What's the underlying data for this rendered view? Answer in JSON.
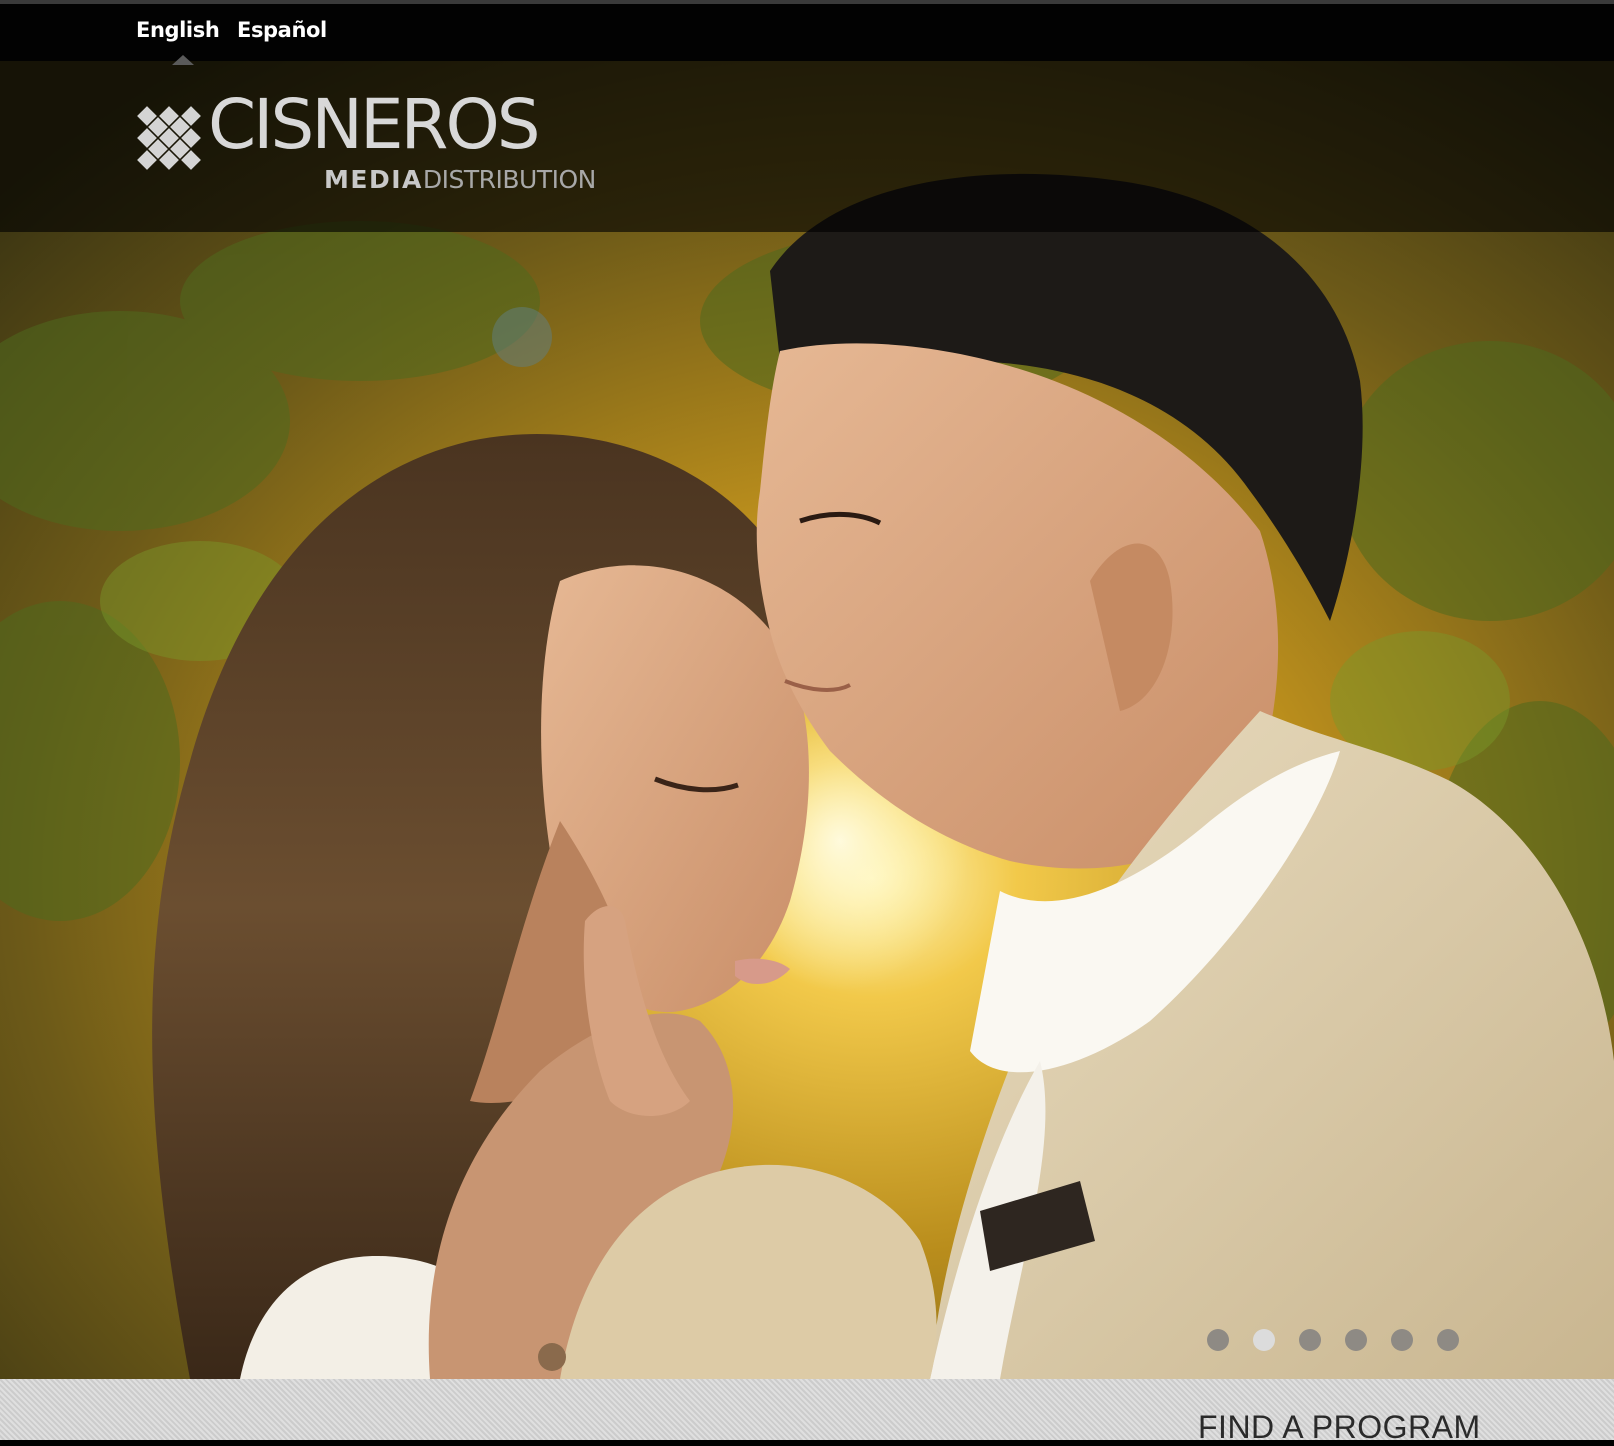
{
  "language_bar": {
    "items": [
      {
        "label": "English",
        "selected": true
      },
      {
        "label": "Español",
        "selected": false
      }
    ]
  },
  "logo": {
    "name": "CISNEROS",
    "sub_bold": "MEDIA",
    "sub_light": "DISTRIBUTION"
  },
  "carousel": {
    "slide_count": 6,
    "active_index": 1
  },
  "footer": {
    "find_program_label": "FIND A PROGRAM"
  },
  "colors": {
    "topbar": "#020202",
    "footer_bg": "#d4d4d4",
    "dot_active": "#dcdcdc",
    "dot_inactive": "#8e8a84"
  }
}
